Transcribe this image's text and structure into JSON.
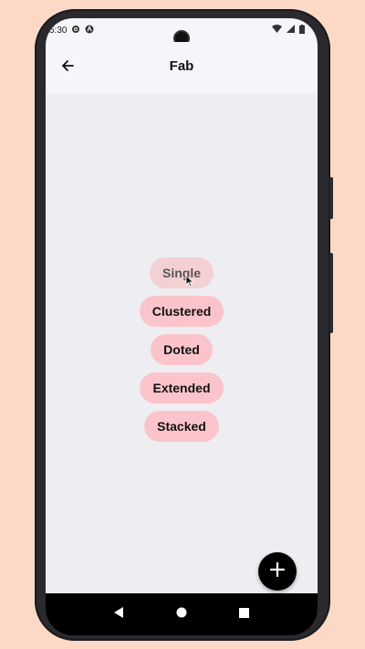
{
  "status_bar": {
    "time": "5:30"
  },
  "app_bar": {
    "title": "Fab"
  },
  "menu": {
    "items": [
      {
        "label": "Single"
      },
      {
        "label": "Clustered"
      },
      {
        "label": "Doted"
      },
      {
        "label": "Extended"
      },
      {
        "label": "Stacked"
      }
    ]
  },
  "colors": {
    "background": "#fcd9c6",
    "button_pink": "#fbc4cb",
    "screen_bg": "#eeedf2"
  },
  "icons": {
    "status_left": [
      "gear-icon",
      "accessibility-icon"
    ],
    "status_right": [
      "wifi-icon",
      "signal-icon",
      "battery-icon"
    ],
    "app_bar": [
      "back-arrow-icon"
    ],
    "fab": "plus-icon",
    "nav": [
      "back-triangle-icon",
      "home-circle-icon",
      "recents-square-icon"
    ]
  }
}
